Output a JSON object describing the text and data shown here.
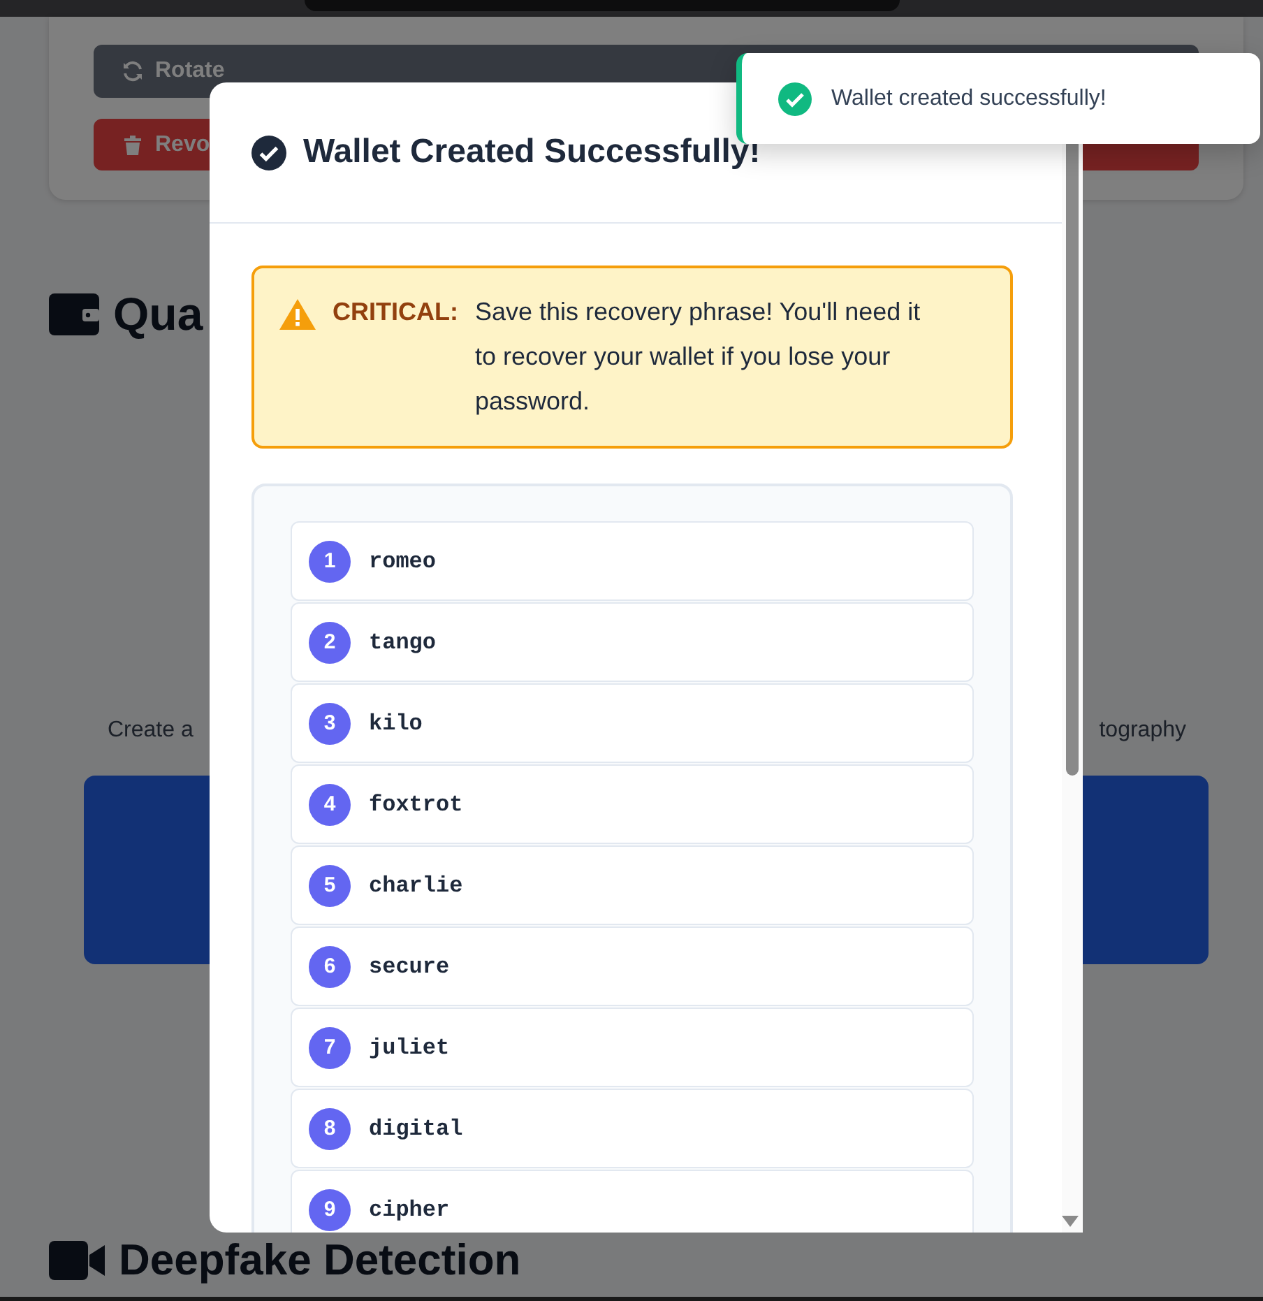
{
  "background": {
    "buttons": [
      {
        "label": "Rotate",
        "kind": "rotate"
      },
      {
        "label": "Revo",
        "kind": "revoke"
      }
    ],
    "section_heading": "Qua",
    "description_left": "Create a",
    "description_right": "tography",
    "next_heading": "Deepfake Detection"
  },
  "modal": {
    "title": "Wallet Created Successfully!",
    "alert": {
      "label": "CRITICAL:",
      "message": "Save this recovery phrase! You'll need it to recover your wallet if you lose your password."
    },
    "words": [
      {
        "index": "1",
        "word": "romeo"
      },
      {
        "index": "2",
        "word": "tango"
      },
      {
        "index": "3",
        "word": "kilo"
      },
      {
        "index": "4",
        "word": "foxtrot"
      },
      {
        "index": "5",
        "word": "charlie"
      },
      {
        "index": "6",
        "word": "secure"
      },
      {
        "index": "7",
        "word": "juliet"
      },
      {
        "index": "8",
        "word": "digital"
      },
      {
        "index": "9",
        "word": "cipher"
      }
    ]
  },
  "toast": {
    "message": "Wallet created successfully!",
    "kind": "success"
  }
}
